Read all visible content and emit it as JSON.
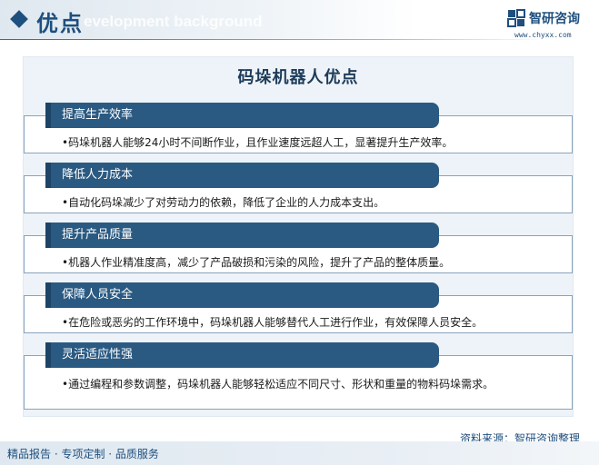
{
  "header": {
    "title": "优点",
    "watermark_text": "evelopment background"
  },
  "logo": {
    "name": "智研咨询",
    "url": "www.chyxx.com"
  },
  "watermark": "智研咨询",
  "panel": {
    "title": "码垛机器人优点",
    "items": [
      {
        "heading": "提高生产效率",
        "text": "•码垛机器人能够24小时不间断作业，且作业速度远超人工，显著提升生产效率。"
      },
      {
        "heading": "降低人力成本",
        "text": "•自动化码垛减少了对劳动力的依赖，降低了企业的人力成本支出。"
      },
      {
        "heading": "提升产品质量",
        "text": "•机器人作业精准度高，减少了产品破损和污染的风险，提升了产品的整体质量。"
      },
      {
        "heading": "保障人员安全",
        "text": "•在危险或恶劣的工作环境中，码垛机器人能够替代人工进行作业，有效保障人员安全。"
      },
      {
        "heading": "灵活适应性强",
        "text": "•通过编程和参数调整，码垛机器人能够轻松适应不同尺寸、形状和重量的物料码垛需求。"
      }
    ]
  },
  "source": "资料来源：智研咨询整理",
  "footer": "精品报告 · 专项定制 · 品质服务",
  "colors": {
    "primary": "#1e4f7e",
    "tab": "#2a5a82",
    "panel_bg": "#edf3f8",
    "item_border": "#8aa3ba"
  }
}
